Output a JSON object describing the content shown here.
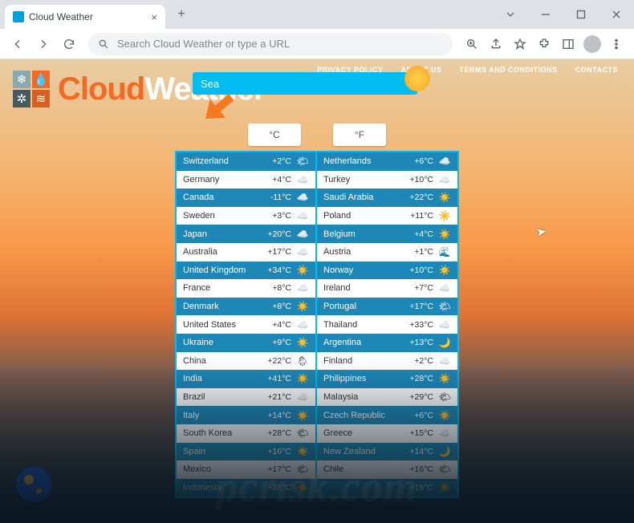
{
  "window": {
    "tab_title": "Cloud Weather",
    "omnibox_placeholder": "Search Cloud Weather or type a URL"
  },
  "nav": {
    "privacy": "PRIVACY POLICY",
    "about": "ABOUT US",
    "terms": "TERMS AND CONDITIONS",
    "contacts": "CONTACTS"
  },
  "brand": {
    "part1": "Cloud",
    "part2": "Weather"
  },
  "search_placeholder": "Sea",
  "units": {
    "celsius": "°C",
    "fahrenheit": "°F"
  },
  "columns": {
    "left": [
      {
        "country": "Switzerland",
        "temp": "+2°C",
        "icon": "🌤"
      },
      {
        "country": "Germany",
        "temp": "+4°C",
        "icon": "☁️"
      },
      {
        "country": "Canada",
        "temp": "-11°C",
        "icon": "☁️"
      },
      {
        "country": "Sweden",
        "temp": "+3°C",
        "icon": "☁️"
      },
      {
        "country": "Japan",
        "temp": "+20°C",
        "icon": "☁️"
      },
      {
        "country": "Australia",
        "temp": "+17°C",
        "icon": "☁️"
      },
      {
        "country": "United Kingdom",
        "temp": "+34°C",
        "icon": "☀️"
      },
      {
        "country": "France",
        "temp": "+8°C",
        "icon": "☁️"
      },
      {
        "country": "Denmark",
        "temp": "+8°C",
        "icon": "☀️"
      },
      {
        "country": "United States",
        "temp": "+4°C",
        "icon": "☁️"
      },
      {
        "country": "Ukraine",
        "temp": "+9°C",
        "icon": "☀️"
      },
      {
        "country": "China",
        "temp": "+22°C",
        "icon": "🌦"
      },
      {
        "country": "India",
        "temp": "+41°C",
        "icon": "☀️"
      },
      {
        "country": "Brazil",
        "temp": "+21°C",
        "icon": "☁️"
      },
      {
        "country": "Italy",
        "temp": "+14°C",
        "icon": "☀️"
      },
      {
        "country": "South Korea",
        "temp": "+28°C",
        "icon": "🌤"
      },
      {
        "country": "Spain",
        "temp": "+16°C",
        "icon": "☀️"
      },
      {
        "country": "Mexico",
        "temp": "+17°C",
        "icon": "🌤"
      },
      {
        "country": "Indonesia",
        "temp": "+28°C",
        "icon": "☀️"
      }
    ],
    "right": [
      {
        "country": "Netherlands",
        "temp": "+6°C",
        "icon": "☁️"
      },
      {
        "country": "Turkey",
        "temp": "+10°C",
        "icon": "☁️"
      },
      {
        "country": "Saudi Arabia",
        "temp": "+22°C",
        "icon": "☀️"
      },
      {
        "country": "Poland",
        "temp": "+11°C",
        "icon": "☀️"
      },
      {
        "country": "Belgium",
        "temp": "+4°C",
        "icon": "☀️"
      },
      {
        "country": "Austria",
        "temp": "+1°C",
        "icon": "🌊"
      },
      {
        "country": "Norway",
        "temp": "+10°C",
        "icon": "☀️"
      },
      {
        "country": "Ireland",
        "temp": "+7°C",
        "icon": "☁️"
      },
      {
        "country": "Portugal",
        "temp": "+17°C",
        "icon": "🌤"
      },
      {
        "country": "Thailand",
        "temp": "+33°C",
        "icon": "☁️"
      },
      {
        "country": "Argentina",
        "temp": "+13°C",
        "icon": "🌙"
      },
      {
        "country": "Finland",
        "temp": "+2°C",
        "icon": "☁️"
      },
      {
        "country": "Philippines",
        "temp": "+28°C",
        "icon": "☀️"
      },
      {
        "country": "Malaysia",
        "temp": "+29°C",
        "icon": "🌤"
      },
      {
        "country": "Czech Republic",
        "temp": "+6°C",
        "icon": "☀️"
      },
      {
        "country": "Greece",
        "temp": "+15°C",
        "icon": "☁️"
      },
      {
        "country": "New Zealand",
        "temp": "+14°C",
        "icon": "🌙"
      },
      {
        "country": "Chile",
        "temp": "+16°C",
        "icon": "🌤"
      },
      {
        "country": "",
        "temp": "+18°C",
        "icon": "☀️"
      }
    ]
  },
  "watermark": "pcrisk.com"
}
